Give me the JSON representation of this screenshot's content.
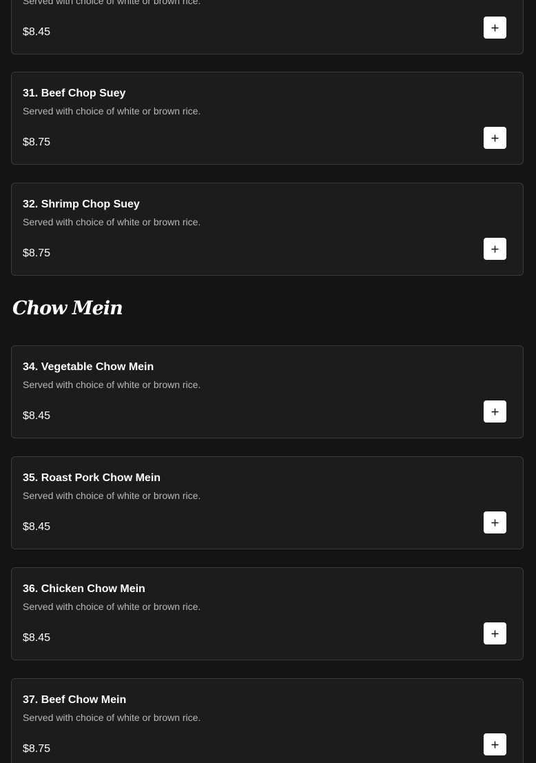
{
  "menu": {
    "items_top": [
      {
        "name": "",
        "description": "Served with choice of white or brown rice.",
        "price": "$8.45"
      },
      {
        "name": "31. Beef Chop Suey",
        "description": "Served with choice of white or brown rice.",
        "price": "$8.75"
      },
      {
        "name": "32. Shrimp Chop Suey",
        "description": "Served with choice of white or brown rice.",
        "price": "$8.75"
      }
    ],
    "chow_mein": {
      "heading": "Chow Mein",
      "items": [
        {
          "name": "34. Vegetable Chow Mein",
          "description": "Served with choice of white or brown rice.",
          "price": "$8.45"
        },
        {
          "name": "35. Roast Pork Chow Mein",
          "description": "Served with choice of white or brown rice.",
          "price": "$8.45"
        },
        {
          "name": "36. Chicken Chow Mein",
          "description": "Served with choice of white or brown rice.",
          "price": "$8.45"
        },
        {
          "name": "37. Beef Chow Mein",
          "description": "Served with choice of white or brown rice.",
          "price": "$8.75"
        }
      ]
    },
    "add_icon": "plus-icon"
  }
}
